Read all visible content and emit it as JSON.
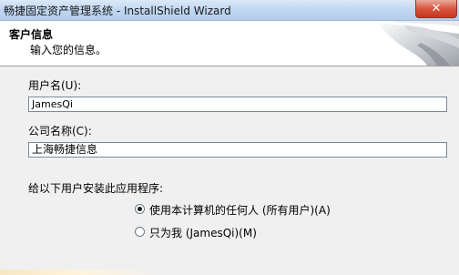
{
  "window": {
    "title": "畅捷固定资产管理系统 - InstallShield Wizard",
    "close_glyph": "✕"
  },
  "header": {
    "title": "客户信息",
    "subtitle": "输入您的信息。"
  },
  "form": {
    "username_label": "用户名(U):",
    "username_value": "JamesQi",
    "company_label": "公司名称(C):",
    "company_value": "上海畅捷信息",
    "install_for_label": "给以下用户安装此应用程序:",
    "options": [
      {
        "label": "使用本计算机的任何人 (所有用户)(A)",
        "selected": true
      },
      {
        "label": "只为我 (JamesQi)(M)",
        "selected": false
      }
    ]
  },
  "colors": {
    "titlebar": "#c2d8f1",
    "close_button": "#d8553c",
    "dialog_bg": "#f0f0f0"
  }
}
